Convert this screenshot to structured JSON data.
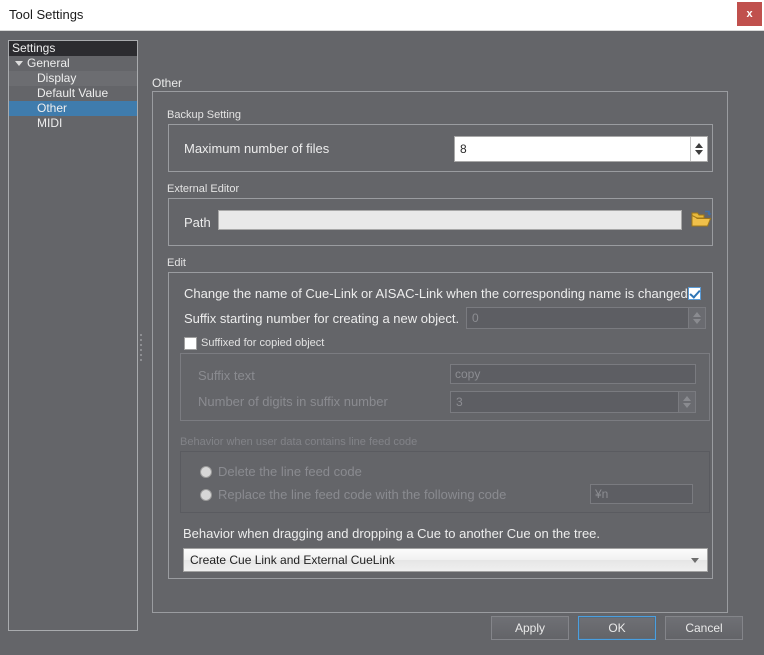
{
  "window": {
    "title": "Tool Settings",
    "close_label": "x"
  },
  "tree": {
    "header": "Settings",
    "items": [
      {
        "label": "General",
        "level": 0,
        "expanded": true,
        "selected": false
      },
      {
        "label": "Display",
        "level": 1,
        "expanded": false,
        "selected": false
      },
      {
        "label": "Default Value",
        "level": 1,
        "expanded": false,
        "selected": false
      },
      {
        "label": "Other",
        "level": 1,
        "expanded": false,
        "selected": true
      },
      {
        "label": "MIDI",
        "level": 1,
        "expanded": false,
        "selected": false
      }
    ]
  },
  "content": {
    "page_title": "Other",
    "backup": {
      "caption": "Backup Setting",
      "max_files_label": "Maximum number of files",
      "max_files_value": "8"
    },
    "external_editor": {
      "caption": "External Editor",
      "path_label": "Path",
      "path_value": "",
      "browse_icon": "folder-open-icon"
    },
    "edit": {
      "caption": "Edit",
      "change_name_label": "Change the name of Cue-Link or AISAC-Link when the corresponding name is changed",
      "change_name_checked": true,
      "suffix_start_label": "Suffix starting number for creating a new object.",
      "suffix_start_value": "0",
      "suffixed_copy_label": "Suffixed for copied object",
      "suffixed_copy_checked": false,
      "suffix_text_label": "Suffix text",
      "suffix_text_value": "copy",
      "suffix_digits_label": "Number of digits in suffix number",
      "suffix_digits_value": "3",
      "linefeed_caption": "Behavior when user data contains line feed code",
      "linefeed_option_delete": "Delete the line feed code",
      "linefeed_option_replace": "Replace the line feed code with the following code",
      "linefeed_code_value": "¥n",
      "dragdrop_label": "Behavior when dragging and dropping a Cue to another Cue on the tree.",
      "dragdrop_selected": "Create Cue Link and External CueLink"
    }
  },
  "footer": {
    "apply_label": "Apply",
    "ok_label": "OK",
    "cancel_label": "Cancel"
  },
  "colors": {
    "window_background": "#646569",
    "titlebar_background": "#ffffff",
    "close_button": "#c0504d",
    "tree_selection": "#3f7cad",
    "tree_header": "#2c2c30",
    "accent_focus": "#4a9fe0",
    "checkbox_check": "#2e75b6"
  }
}
